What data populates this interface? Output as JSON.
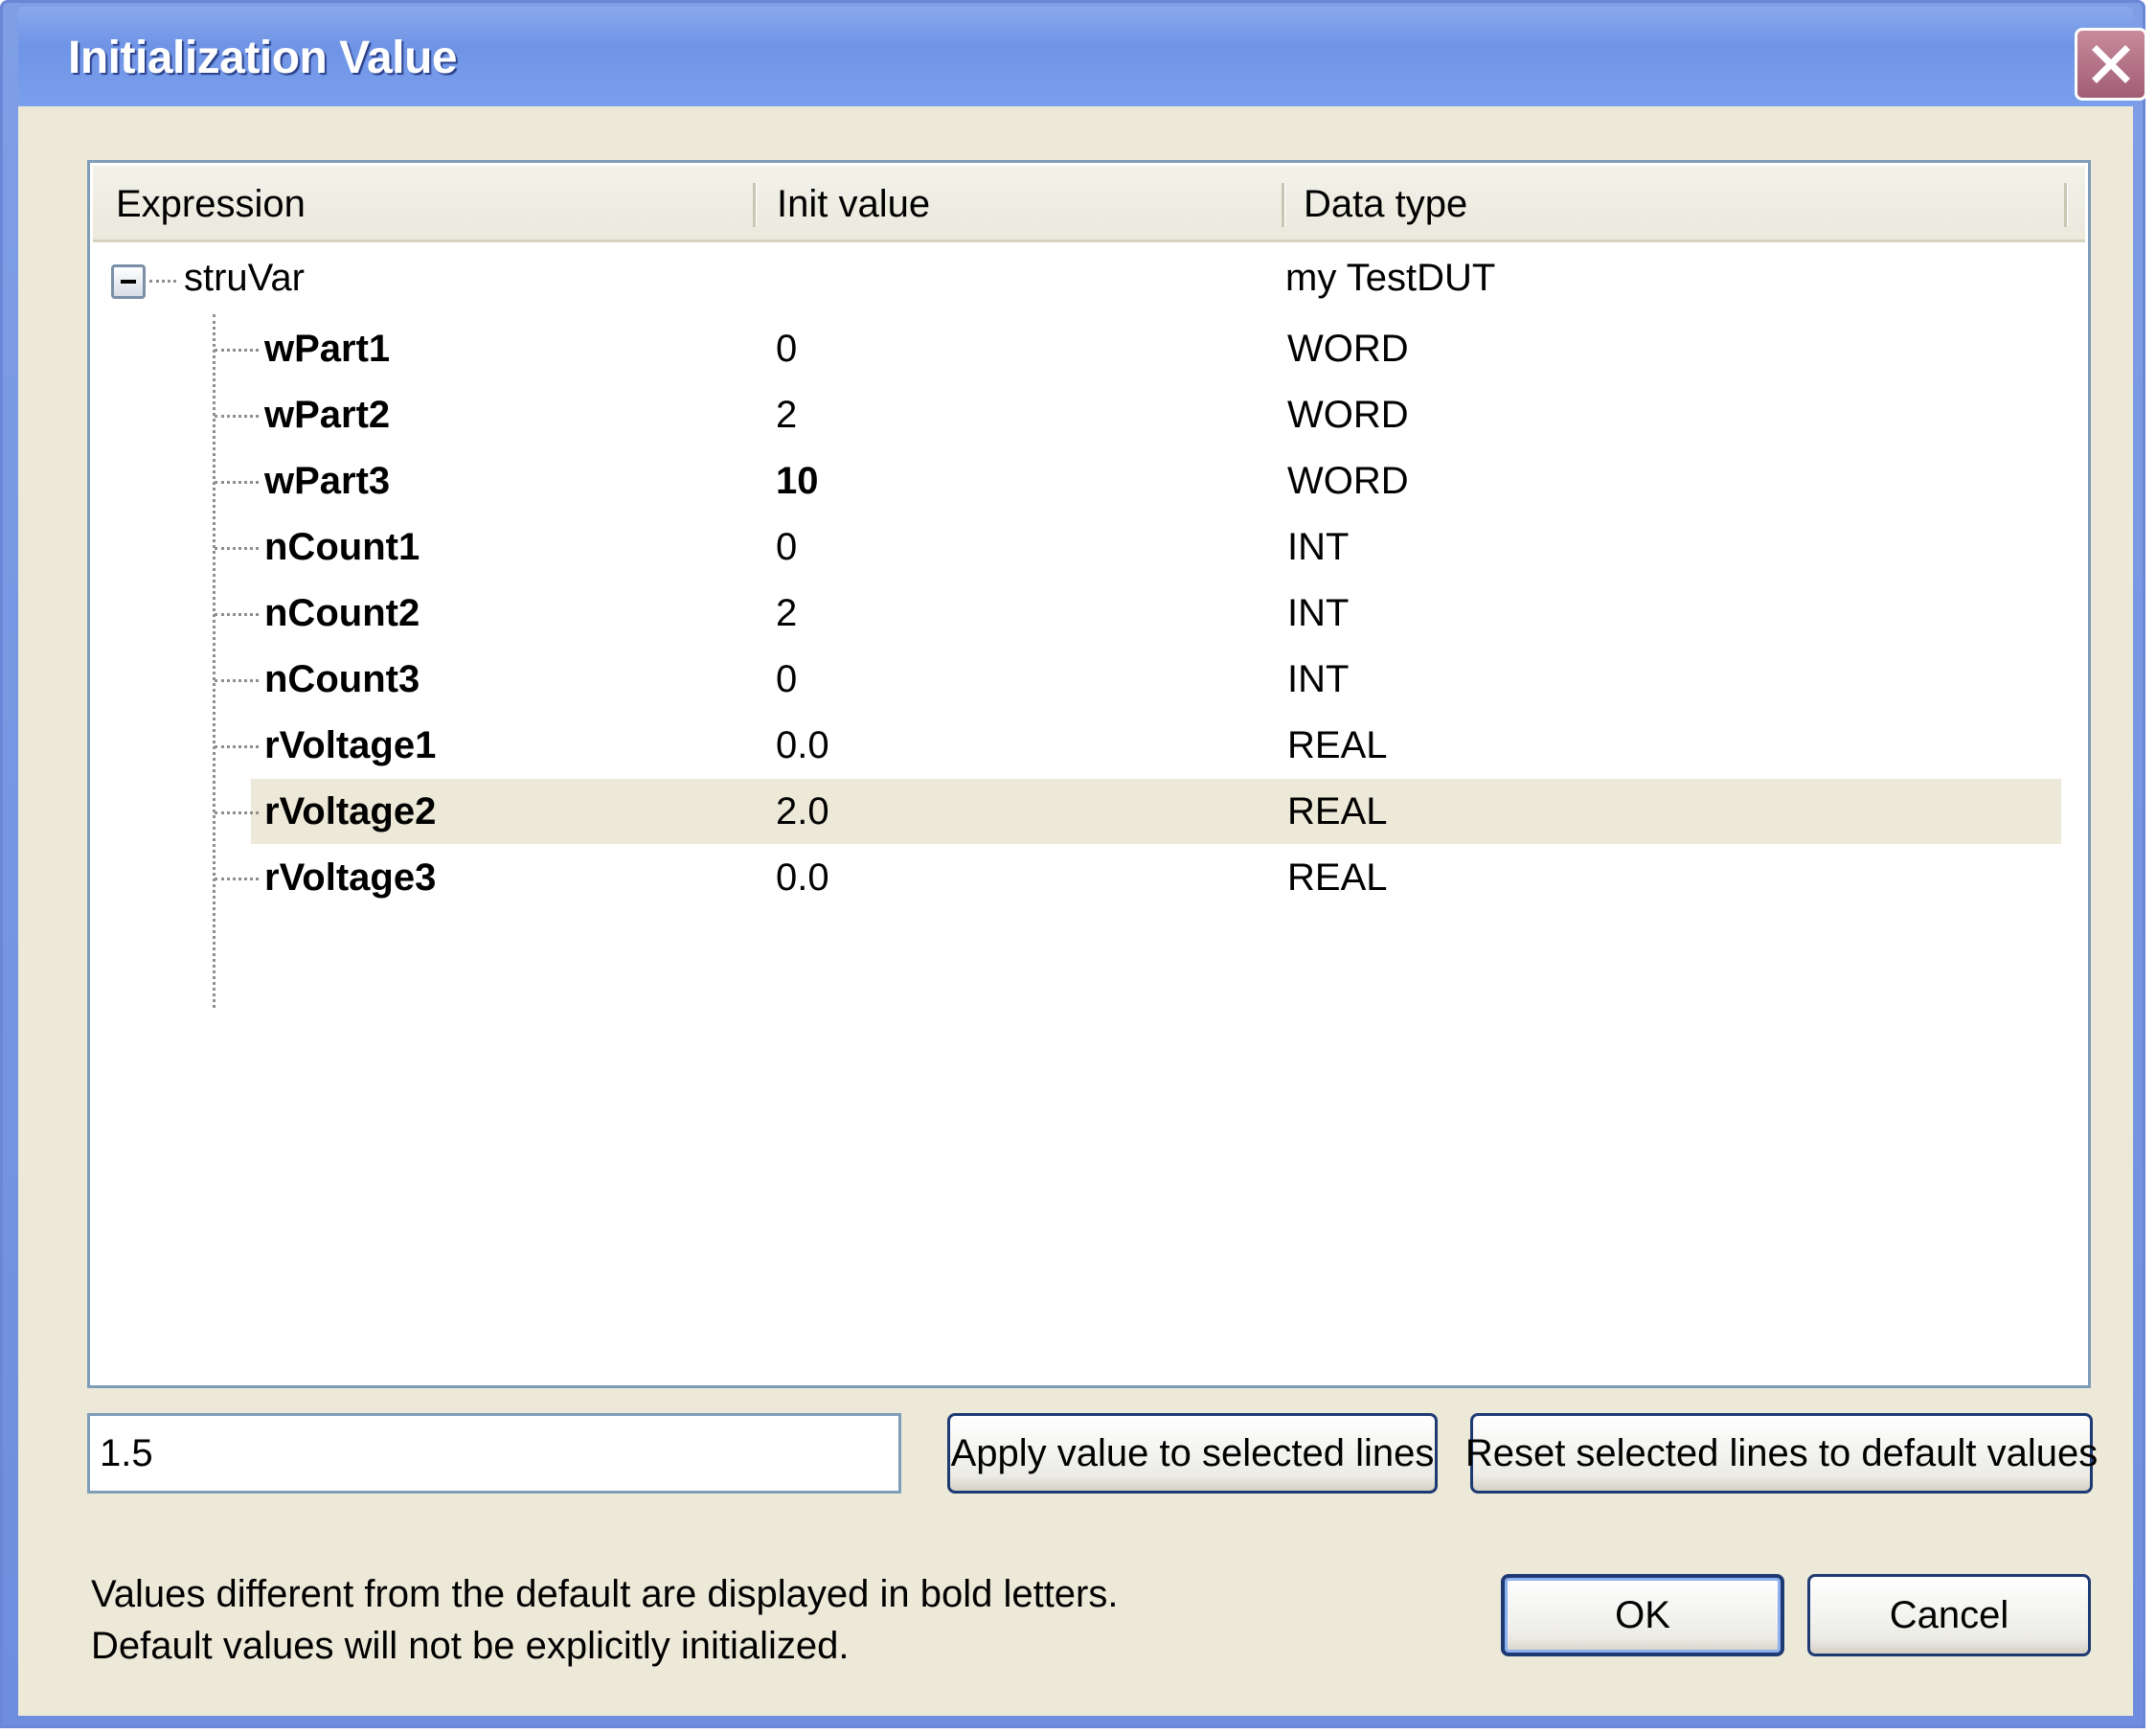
{
  "window": {
    "title": "Initialization Value"
  },
  "table": {
    "columns": [
      "Expression",
      "Init value",
      "Data type"
    ],
    "root": {
      "expression": "struVar",
      "init_value": "",
      "data_type": "my TestDUT"
    },
    "rows": [
      {
        "expression": "wPart1",
        "init_value": "0",
        "data_type": "WORD",
        "value_bold": false
      },
      {
        "expression": "wPart2",
        "init_value": "2",
        "data_type": "WORD",
        "value_bold": false
      },
      {
        "expression": "wPart3",
        "init_value": "10",
        "data_type": "WORD",
        "value_bold": true
      },
      {
        "expression": "nCount1",
        "init_value": "0",
        "data_type": "INT",
        "value_bold": false
      },
      {
        "expression": "nCount2",
        "init_value": "2",
        "data_type": "INT",
        "value_bold": false
      },
      {
        "expression": "nCount3",
        "init_value": "0",
        "data_type": "INT",
        "value_bold": false
      },
      {
        "expression": "rVoltage1",
        "init_value": "0.0",
        "data_type": "REAL",
        "value_bold": false
      },
      {
        "expression": "rVoltage2",
        "init_value": "2.0",
        "data_type": "REAL",
        "value_bold": false
      },
      {
        "expression": "rVoltage3",
        "init_value": "0.0",
        "data_type": "REAL",
        "value_bold": false
      }
    ],
    "selected_row": 7
  },
  "value_field": {
    "value": "1.5"
  },
  "buttons": {
    "apply": "Apply value to selected lines",
    "reset": "Reset selected lines to default values",
    "ok": "OK",
    "cancel": "Cancel"
  },
  "info": {
    "line1": "Values different from the default are displayed in bold letters.",
    "line2": "Default values will not be explicitly initialized."
  },
  "icons": {
    "close": "close-icon",
    "collapse": "minus-box-icon"
  },
  "colors": {
    "titlebar": "#7aa0ec",
    "client": "#ece9d8",
    "selected_row": "#ece9d8",
    "button_border": "#1d3a72"
  }
}
